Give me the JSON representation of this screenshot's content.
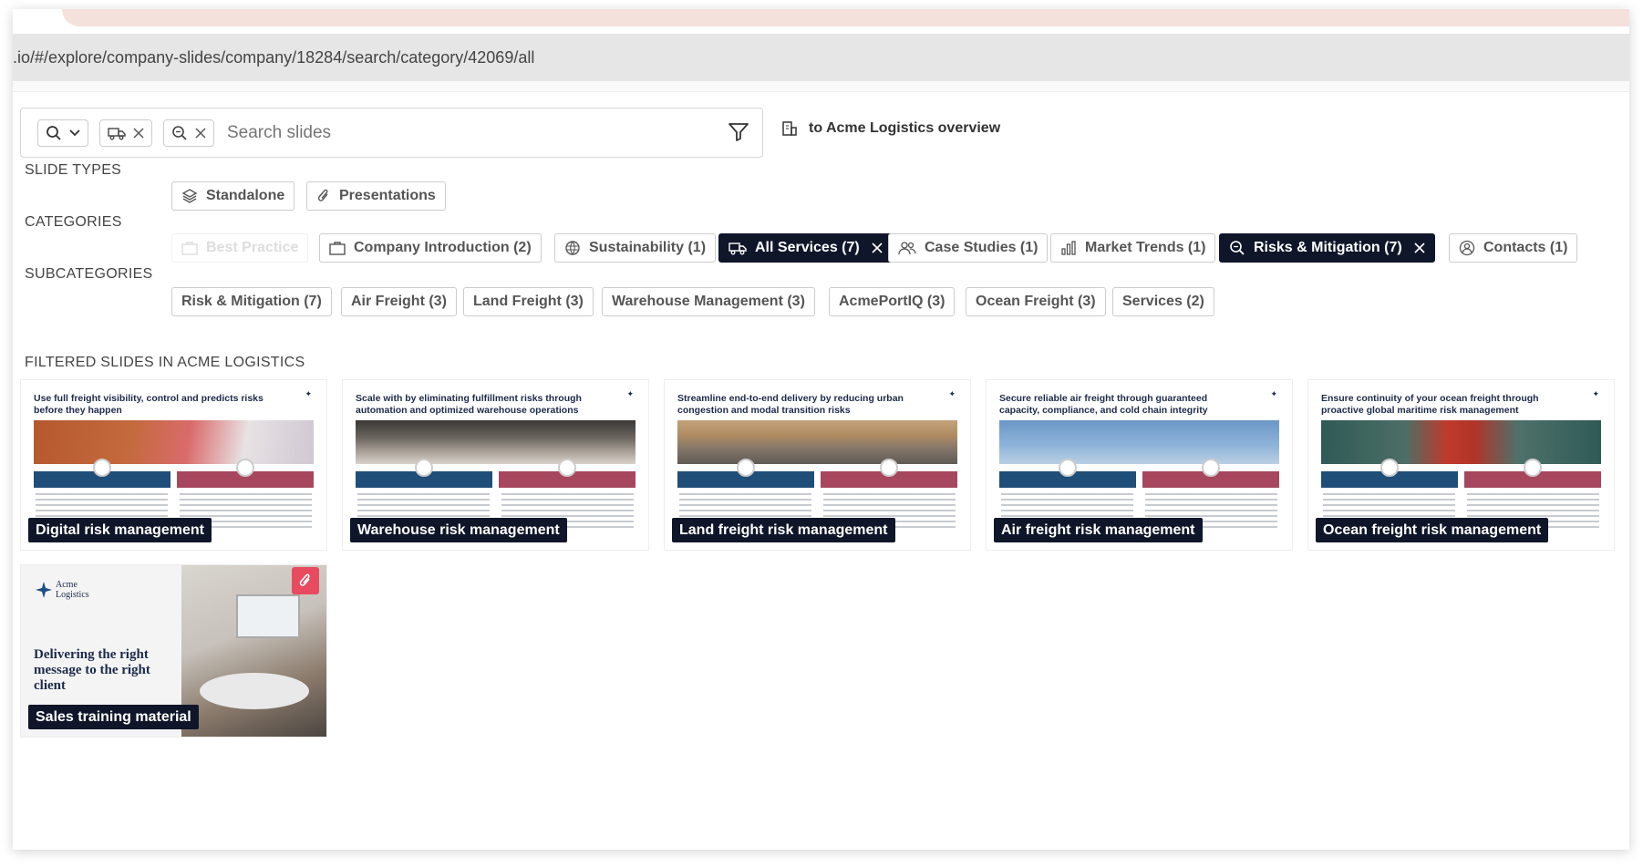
{
  "browser": {
    "url": ".io/#/explore/company-slides/company/18284/search/category/42069/all"
  },
  "search": {
    "placeholder": "Search slides",
    "back_link": "to Acme Logistics overview"
  },
  "slide_types": {
    "label": "SLIDE TYPES",
    "items": [
      "Standalone",
      "Presentations"
    ]
  },
  "categories": {
    "label": "CATEGORIES",
    "items": [
      {
        "label": "Best Practice",
        "state": "disabled",
        "icon": "briefcase-icon"
      },
      {
        "label": "Company Introduction (2)",
        "state": "normal",
        "icon": "briefcase-icon"
      },
      {
        "label": "Sustainability (1)",
        "state": "normal",
        "icon": "globe-icon"
      },
      {
        "label": "All Services (7)",
        "state": "active",
        "icon": "truck-icon"
      },
      {
        "label": "Case Studies (1)",
        "state": "normal",
        "icon": "people-icon"
      },
      {
        "label": "Market Trends (1)",
        "state": "normal",
        "icon": "bar-chart-icon"
      },
      {
        "label": "Risks & Mitigation (7)",
        "state": "active",
        "icon": "zoom-search-icon"
      },
      {
        "label": "Contacts (1)",
        "state": "normal",
        "icon": "person-circle-icon"
      }
    ]
  },
  "subcategories": {
    "label": "SUBCATEGORIES",
    "items": [
      "Risk & Mitigation (7)",
      "Air Freight (3)",
      "Land Freight (3)",
      "Warehouse Management (3)",
      "AcmePortIQ (3)",
      "Ocean Freight (3)",
      "Services (2)"
    ]
  },
  "results": {
    "label": "FILTERED SLIDES IN ACME LOGISTICS",
    "cards": [
      {
        "title": "Use full freight visibility, control and predicts risks before they happen",
        "name": "Digital risk management"
      },
      {
        "title": "Scale with by eliminating fulfillment risks through automation and optimized warehouse operations",
        "name": "Warehouse risk management"
      },
      {
        "title": "Streamline end-to-end delivery by reducing urban congestion and modal transition risks",
        "name": "Land freight risk management"
      },
      {
        "title": "Secure reliable air freight through guaranteed capacity, compliance, and cold chain integrity",
        "name": "Air freight risk management"
      },
      {
        "title": "Ensure continuity of your ocean freight through proactive global maritime risk management",
        "name": "Ocean freight risk management"
      }
    ],
    "presentation": {
      "brand": "Acme Logistics",
      "headline": "Delivering the right message to the right client",
      "name": "Sales training material"
    }
  }
}
